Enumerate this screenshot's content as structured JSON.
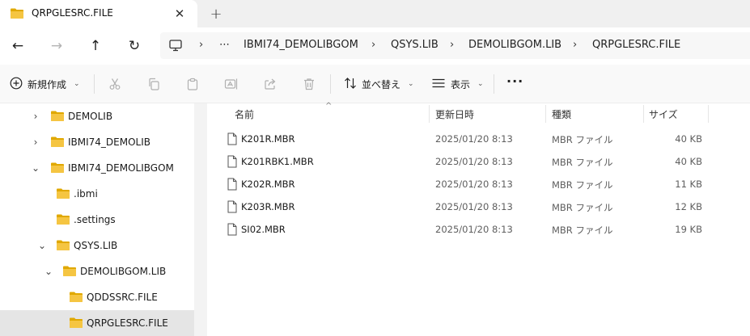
{
  "tab": {
    "title": "QRPGLESRC.FILE",
    "close": "✕",
    "new": "+"
  },
  "nav": {
    "back": "←",
    "forward": "→",
    "up": "↑",
    "refresh": "↻"
  },
  "address": {
    "more": "⋯",
    "crumbs": [
      "IBMI74_DEMOLIBGOM",
      "QSYS.LIB",
      "DEMOLIBGOM.LIB",
      "QRPGLESRC.FILE"
    ],
    "sep": "›"
  },
  "toolbar": {
    "new_label": "新規作成",
    "sort_label": "並べ替え",
    "view_label": "表示",
    "more": "···",
    "chev": "⌄"
  },
  "sidebar": {
    "items": [
      {
        "label": "DEMOLIB",
        "chev": "›"
      },
      {
        "label": "IBMI74_DEMOLIB",
        "chev": "›"
      },
      {
        "label": "IBMI74_DEMOLIBGOM",
        "chev": "⌄"
      },
      {
        "label": ".ibmi"
      },
      {
        "label": ".settings"
      },
      {
        "label": "QSYS.LIB",
        "chev": "⌄"
      },
      {
        "label": "DEMOLIBGOM.LIB",
        "chev": "⌄"
      },
      {
        "label": "QDDSSRC.FILE"
      },
      {
        "label": "QRPGLESRC.FILE"
      }
    ]
  },
  "columns": {
    "name": "名前",
    "date": "更新日時",
    "type": "種類",
    "size": "サイズ",
    "sort_caret": "^"
  },
  "files": [
    {
      "name": "K201R.MBR",
      "date": "2025/01/20 8:13",
      "type": "MBR ファイル",
      "size": "40 KB"
    },
    {
      "name": "K201RBK1.MBR",
      "date": "2025/01/20 8:13",
      "type": "MBR ファイル",
      "size": "40 KB"
    },
    {
      "name": "K202R.MBR",
      "date": "2025/01/20 8:13",
      "type": "MBR ファイル",
      "size": "11 KB"
    },
    {
      "name": "K203R.MBR",
      "date": "2025/01/20 8:13",
      "type": "MBR ファイル",
      "size": "12 KB"
    },
    {
      "name": "SI02.MBR",
      "date": "2025/01/20 8:13",
      "type": "MBR ファイル",
      "size": "19 KB"
    }
  ],
  "colors": {
    "folder": "#f5c542",
    "folder_dark": "#e0a800",
    "selected": "#e5e5e5"
  }
}
